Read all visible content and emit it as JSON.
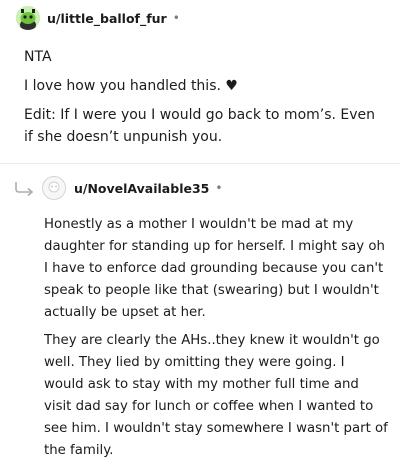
{
  "comment1": {
    "username": "u/little_ballof_fur",
    "separator": "•",
    "paragraphs": [
      "NTA",
      "I love how you handled this. ♥",
      "Edit: If I were you I would go back to mom’s. Even if she doesn’t unpunish you."
    ]
  },
  "comment2": {
    "username": "u/NovelAvailable35",
    "separator": "•",
    "paragraphs": [
      "Honestly as a mother I wouldn't be mad at my daughter for standing up for herself. I might say oh I have to enforce dad grounding because you can't speak to people like that (swearing) but I wouldn't actually be upset at her.",
      "They are clearly the AHs..they knew it wouldn't go well. They lied by omitting they were going. I would ask to stay with my mother full time and visit dad say for lunch or coffee when I wanted to see him. I wouldn't stay somewhere I wasn't part of the family."
    ]
  }
}
